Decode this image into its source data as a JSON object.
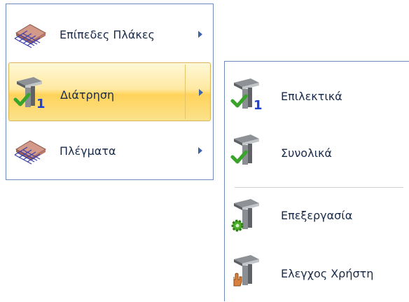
{
  "main_menu": {
    "items": [
      {
        "label": "Επίπεδες Πλάκες",
        "icon": "slab-mesh-icon",
        "has_submenu": true
      },
      {
        "label": "Διάτρηση",
        "icon": "punching-column-check-1-icon",
        "has_submenu": true,
        "highlighted": true
      },
      {
        "label": "Πλέγματα",
        "icon": "slab-mesh-icon",
        "has_submenu": true
      }
    ]
  },
  "sub_menu": {
    "items": [
      {
        "label": "Επιλεκτικά",
        "icon": "column-check-1-icon"
      },
      {
        "label": "Συνολικά",
        "icon": "column-check-icon"
      },
      {
        "label": "Επεξεργασία",
        "icon": "column-gear-icon"
      },
      {
        "label": "Ελεγχος Χρήστη",
        "icon": "column-hand-icon"
      }
    ]
  },
  "colors": {
    "menu_border": "#6d8cbc",
    "highlight_top": "#fff8d8",
    "highlight_bottom": "#ffd35a",
    "arrow": "#3f64a6",
    "text": "#1a2b4a",
    "check_green": "#3aa32c",
    "number_blue": "#1f3fd0"
  }
}
